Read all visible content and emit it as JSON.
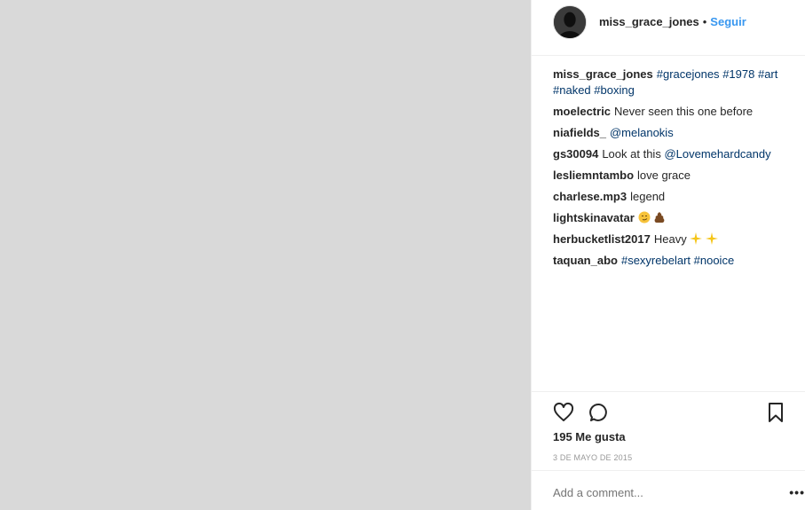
{
  "header": {
    "username": "miss_grace_jones",
    "separator": "•",
    "follow_label": "Seguir"
  },
  "caption": {
    "username": "miss_grace_jones",
    "hashtags": [
      "#gracejones",
      "#1978",
      "#art",
      "#naked",
      "#boxing"
    ]
  },
  "comments": [
    {
      "user": "moelectric",
      "text": "Never seen this one before"
    },
    {
      "user": "niafields_",
      "mention": "@melanokis"
    },
    {
      "user": "gs30094",
      "text": "Look at this",
      "mention": "@Lovemehardcandy"
    },
    {
      "user": "lesliemntambo",
      "text": "love grace"
    },
    {
      "user": "charlese.mp3",
      "text": "legend"
    },
    {
      "user": "lightskinavatar",
      "emojis": [
        "smirk-emoji",
        "poop-emoji"
      ]
    },
    {
      "user": "herbucketlist2017",
      "text": "Heavy",
      "emojis": [
        "sparkles-emoji",
        "sparkles-emoji"
      ]
    },
    {
      "user": "taquan_abo",
      "hashtags": [
        "#sexyrebelart",
        "#nooice"
      ]
    }
  ],
  "likes_text": "195 Me gusta",
  "date_text": "3 DE MAYO DE 2015",
  "add_comment_placeholder": "Add a comment...",
  "more_label": "•••",
  "colors": {
    "link": "#003569",
    "follow": "#3897f0",
    "muted": "#999999"
  },
  "icons": [
    "heart-icon",
    "comment-icon",
    "bookmark-icon"
  ]
}
